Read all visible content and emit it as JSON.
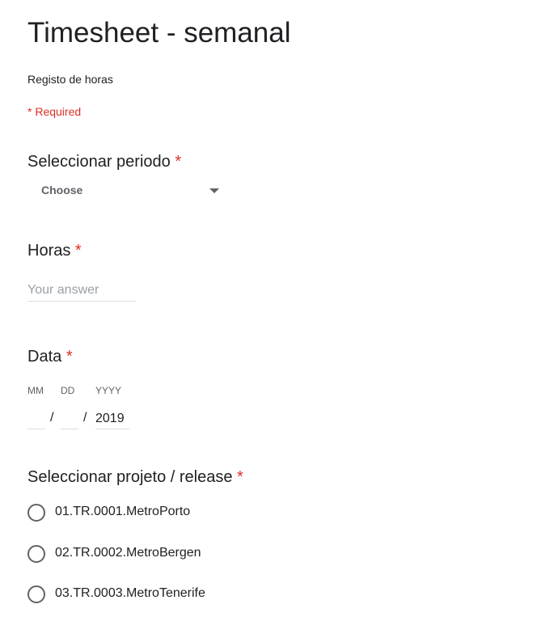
{
  "form": {
    "title": "Timesheet - semanal",
    "description": "Registo de horas",
    "required_note": "* Required"
  },
  "questions": {
    "periodo": {
      "label": "Seleccionar periodo",
      "star": "*",
      "dropdown_value": "Choose"
    },
    "horas": {
      "label": "Horas",
      "star": "*",
      "placeholder": "Your answer"
    },
    "data": {
      "label": "Data",
      "star": "*",
      "mm_label": "MM",
      "dd_label": "DD",
      "yyyy_label": "YYYY",
      "mm_value": "",
      "dd_value": "",
      "yyyy_value": "2019",
      "separator": "/"
    },
    "projeto": {
      "label": "Seleccionar projeto / release",
      "star": "*",
      "options": [
        "01.TR.0001.MetroPorto",
        "02.TR.0002.MetroBergen",
        "03.TR.0003.MetroTenerife"
      ]
    }
  },
  "colors": {
    "required": "#d93025",
    "text": "#202124",
    "muted": "#5f6368"
  },
  "icons": {
    "dropdown": "caret-down-icon",
    "radio": "radio-unchecked-icon"
  }
}
